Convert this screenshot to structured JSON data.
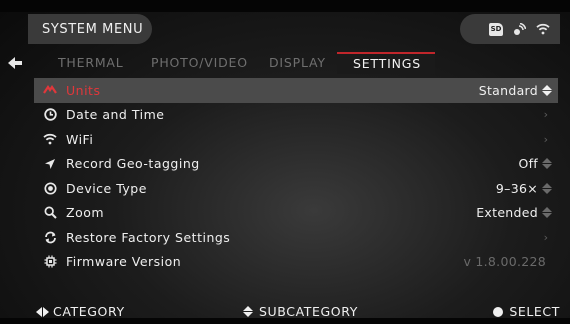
{
  "header": {
    "title": "SYSTEM MENU",
    "status_icons": [
      "sd-card-icon",
      "gps-icon",
      "wifi-icon"
    ],
    "sd_text": "SD"
  },
  "tabs": [
    {
      "label": "THERMAL",
      "active": false
    },
    {
      "label": "PHOTO/VIDEO",
      "active": false
    },
    {
      "label": "DISPLAY",
      "active": false
    },
    {
      "label": "SETTINGS",
      "active": true
    }
  ],
  "menu": {
    "items": [
      {
        "label": "Units",
        "value": "Standard",
        "control": "updown",
        "selected": true,
        "icon": "ruler-icon"
      },
      {
        "label": "Date and Time",
        "value": "",
        "control": "chevron",
        "icon": "clock-icon"
      },
      {
        "label": "WiFi",
        "value": "",
        "control": "chevron",
        "icon": "wifi-icon"
      },
      {
        "label": "Record Geo-tagging",
        "value": "Off",
        "control": "updown",
        "icon": "location-arrow-icon"
      },
      {
        "label": "Device Type",
        "value": "9–36×",
        "control": "updown",
        "icon": "target-icon"
      },
      {
        "label": "Zoom",
        "value": "Extended",
        "control": "updown",
        "icon": "magnifier-icon"
      },
      {
        "label": "Restore Factory Settings",
        "value": "",
        "control": "chevron",
        "icon": "refresh-icon"
      },
      {
        "label": "Firmware Version",
        "value": "v 1.8.00.228",
        "control": "none",
        "icon": "chip-icon"
      }
    ],
    "chevron_glyph": "›"
  },
  "footer": {
    "category": "CATEGORY",
    "subcategory": "SUBCATEGORY",
    "select": "SELECT"
  },
  "colors": {
    "accent": "#e0373b",
    "selected_row": "#4b4b4b",
    "pill": "#3a3a3a"
  }
}
